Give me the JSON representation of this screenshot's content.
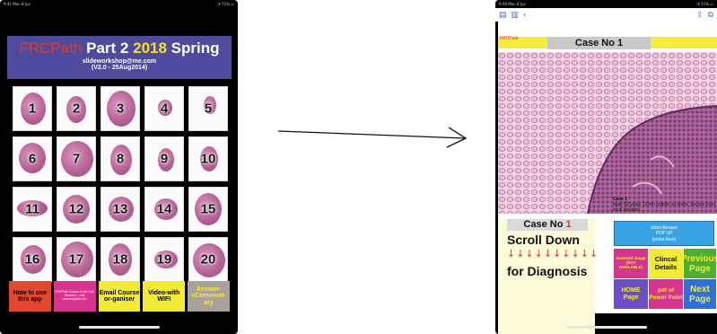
{
  "left_screen": {
    "status": {
      "time": "9:41 Mon 8 Jun",
      "indicators": "◔ 71% ▭"
    },
    "title": {
      "frcpath": "FRCPath",
      "part": "Part 2",
      "year": "2018",
      "season": "Spring",
      "email": "slideworkshop@me.com",
      "version": "(V2.0 - 25Aug2014)"
    },
    "slides": [
      "1",
      "2",
      "3",
      "4",
      "5",
      "6",
      "7",
      "8",
      "9",
      "10",
      "11",
      "12",
      "13",
      "14",
      "15",
      "16",
      "17",
      "18",
      "19",
      "20"
    ],
    "buttons": [
      {
        "label": "How to use this app",
        "bg": "#e2472f",
        "color": "#000000"
      },
      {
        "label": "FRCPath Course in the SoE Deanery - visit www.mypath.info",
        "bg": "#d8338f",
        "color": "#ffffff"
      },
      {
        "label": "Email Course or-ganiser",
        "bg": "#f3ea33",
        "color": "#000000"
      },
      {
        "label": "Video-with WIFI",
        "bg": "#f3ea33",
        "color": "#000000"
      },
      {
        "label": "Answer-sComment-ary",
        "bg": "#a9a19a",
        "color": "#f3ea33"
      }
    ]
  },
  "right_screen": {
    "status": {
      "time": "9:56 Mon 8 Jun",
      "indicators": "◔ 71% ▭"
    },
    "toolbar": {
      "sidebar_icon": "▤",
      "book_icon": "▥",
      "back_icon": "‹",
      "share_icon": "⇪",
      "view_icon": "⧉"
    },
    "frcpath_tag": "FRCPath",
    "header_title": "Case No 1",
    "side_panel": {
      "case_label": "Case No",
      "case_number": "1",
      "scroll_down": "Scroll Down",
      "arrows": "↓↓↓↓↓↓↓↓↓↓",
      "for_diagnosis": "for Diagnosis"
    },
    "case_info": {
      "title": "Case 1",
      "text": "Male 52 years  12mm nodule on testis. Section from local excision."
    },
    "answer_popup": {
      "line1": "Short Answer",
      "line2": "POP UP",
      "line3": "(press here)"
    },
    "actions": [
      {
        "label": "Scanned Image (NOT AVAILABLE)",
        "bg": "#d8338f",
        "color": "#f3ea33"
      },
      {
        "label": "Clincal Details",
        "bg": "#f3ea33",
        "color": "#111111"
      },
      {
        "label": "Previous Page",
        "bg": "#4caf2f",
        "color": "#f3ea33"
      },
      {
        "label": "HOME Page",
        "bg": "#6a4fc9",
        "color": "#f3ea33"
      },
      {
        "label": "pdf of Power Point",
        "bg": "#d8338f",
        "color": "#f3ea33"
      },
      {
        "label": "Next Page",
        "bg": "#2e6fd8",
        "color": "#f3ea33"
      }
    ]
  }
}
